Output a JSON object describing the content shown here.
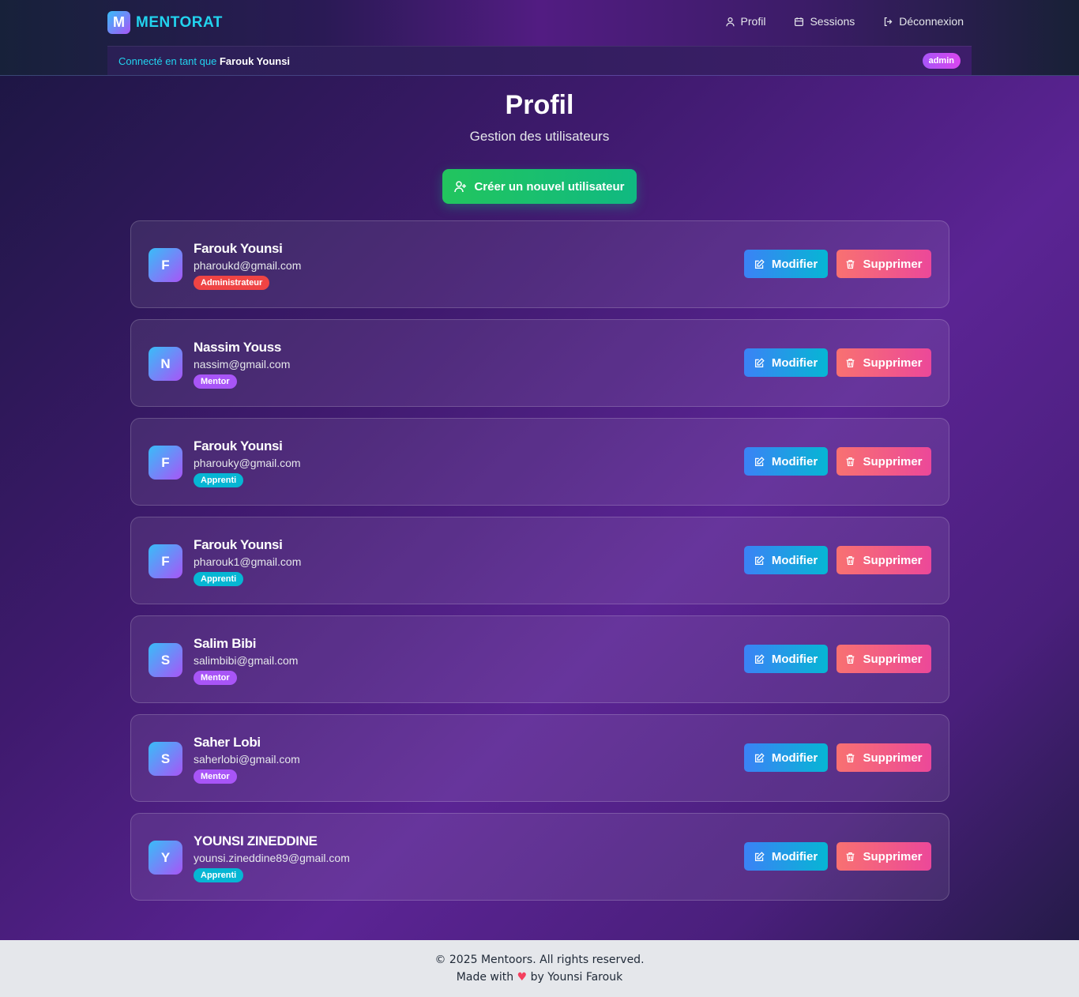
{
  "nav": {
    "logo_letter": "M",
    "logo_text": "MENTORAT",
    "links": [
      {
        "label": "Profil",
        "icon": "user-icon"
      },
      {
        "label": "Sessions",
        "icon": "calendar-icon"
      },
      {
        "label": "Déconnexion",
        "icon": "logout-icon"
      }
    ]
  },
  "userbar": {
    "prefix": "Connecté en tant que",
    "user": "Farouk Younsi",
    "role": "admin"
  },
  "main": {
    "title": "Profil",
    "subtitle": "Gestion des utilisateurs",
    "create_label": "Créer un nouvel utilisateur"
  },
  "users": [
    {
      "initial": "F",
      "name": "Farouk Younsi",
      "email": "pharoukd@gmail.com",
      "role": "Administrateur",
      "role_color": "#ef4444"
    },
    {
      "initial": "N",
      "name": "Nassim Youss",
      "email": "nassim@gmail.com",
      "role": "Mentor",
      "role_color": "#a855f7"
    },
    {
      "initial": "F",
      "name": "Farouk Younsi",
      "email": "pharouky@gmail.com",
      "role": "Apprenti",
      "role_color": "#06b6d4"
    },
    {
      "initial": "F",
      "name": "Farouk Younsi",
      "email": "pharouk1@gmail.com",
      "role": "Apprenti",
      "role_color": "#06b6d4"
    },
    {
      "initial": "S",
      "name": "Salim Bibi",
      "email": "salimbibi@gmail.com",
      "role": "Mentor",
      "role_color": "#a855f7"
    },
    {
      "initial": "S",
      "name": "Saher Lobi",
      "email": "saherlobi@gmail.com",
      "role": "Mentor",
      "role_color": "#a855f7"
    },
    {
      "initial": "Y",
      "name": "YOUNSI ZINEDDINE",
      "email": "younsi.zineddine89@gmail.com",
      "role": "Apprenti",
      "role_color": "#06b6d4"
    }
  ],
  "actions": {
    "edit_label": "Modifier",
    "delete_label": "Supprimer"
  },
  "footer": {
    "copyright": "© 2025 Mentoors. All rights reserved.",
    "made_with": "Made with",
    "heart": "♥",
    "by": "by Younsi Farouk"
  }
}
